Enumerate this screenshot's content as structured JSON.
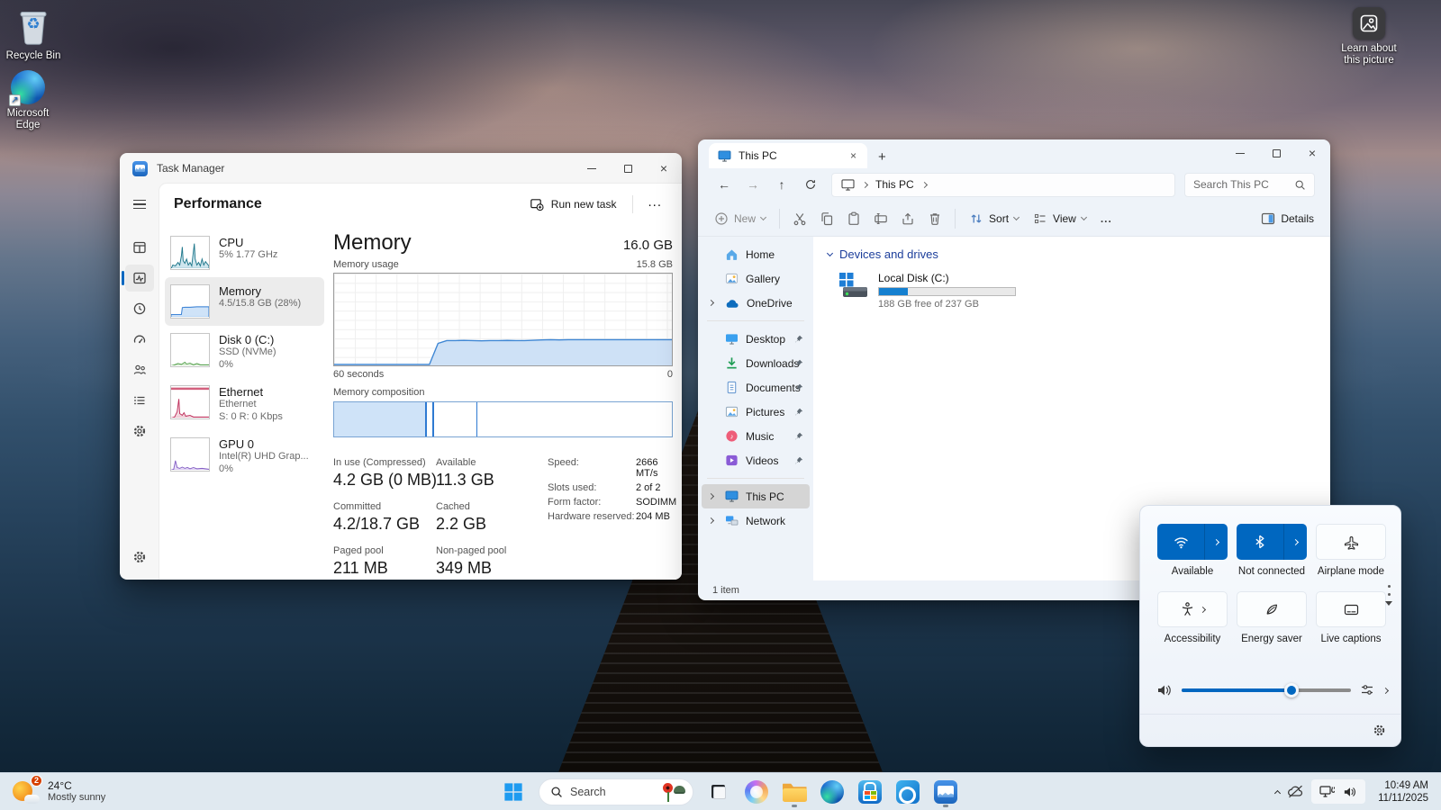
{
  "desktop": {
    "icons": [
      {
        "label": "Recycle Bin",
        "icon": "recycle-bin-icon"
      },
      {
        "label_line1": "Microsoft",
        "label_line2": "Edge",
        "icon": "edge-icon"
      }
    ],
    "learn_about": {
      "label_line1": "Learn about",
      "label_line2": "this picture",
      "icon": "picture-icon"
    }
  },
  "task_manager": {
    "window_title": "Task Manager",
    "page_title": "Performance",
    "run_new_task_label": "Run new task",
    "more_label": "...",
    "perf_items": [
      {
        "name": "CPU",
        "line1": "5% 1.77 GHz"
      },
      {
        "name": "Memory",
        "line1": "4.5/15.8 GB (28%)"
      },
      {
        "name": "Disk 0 (C:)",
        "line1": "SSD (NVMe)",
        "line2": "0%"
      },
      {
        "name": "Ethernet",
        "line1": "Ethernet",
        "line2": "S: 0 R: 0 Kbps"
      },
      {
        "name": "GPU 0",
        "line1": "Intel(R) UHD Grap...",
        "line2": "0%"
      }
    ],
    "memory": {
      "title": "Memory",
      "total": "16.0 GB",
      "usage_label": "Memory usage",
      "scale_top": "15.8 GB",
      "x_left": "60 seconds",
      "x_right": "0",
      "composition_label": "Memory composition",
      "stats": [
        {
          "label": "In use (Compressed)",
          "value": "4.2 GB (0 MB)"
        },
        {
          "label": "Available",
          "value": "11.3 GB"
        },
        {
          "label": "Committed",
          "value": "4.2/18.7 GB"
        },
        {
          "label": "Cached",
          "value": "2.2 GB"
        },
        {
          "label": "Paged pool",
          "value": "211 MB"
        },
        {
          "label": "Non-paged pool",
          "value": "349 MB"
        }
      ],
      "hardware": [
        {
          "label": "Speed:",
          "value": "2666 MT/s"
        },
        {
          "label": "Slots used:",
          "value": "2 of 2"
        },
        {
          "label": "Form factor:",
          "value": "SODIMM"
        },
        {
          "label": "Hardware reserved:",
          "value": "204 MB"
        }
      ],
      "usage_series_pct": [
        1,
        1,
        1,
        1,
        1,
        1,
        1,
        1,
        1,
        1,
        1,
        1,
        24,
        27,
        27,
        27.3,
        27,
        26.8,
        27,
        27,
        27.2,
        27,
        27,
        27.4,
        27.8,
        28,
        27.8,
        28,
        28,
        28,
        28,
        28,
        28,
        28,
        28,
        28,
        28,
        28,
        28,
        28
      ],
      "composition_segments_pct": [
        27.5,
        2,
        13,
        57.5
      ]
    }
  },
  "file_explorer": {
    "tab_title": "This PC",
    "breadcrumb": "This PC",
    "search_placeholder": "Search This PC",
    "toolbar": {
      "new_label": "New",
      "sort_label": "Sort",
      "view_label": "View",
      "more_label": "...",
      "details_label": "Details"
    },
    "nav": {
      "home": "Home",
      "gallery": "Gallery",
      "onedrive": "OneDrive",
      "desktop": "Desktop",
      "downloads": "Downloads",
      "documents": "Documents",
      "pictures": "Pictures",
      "music": "Music",
      "videos": "Videos",
      "this_pc": "This PC",
      "network": "Network"
    },
    "section_header": "Devices and drives",
    "drive": {
      "name": "Local Disk (C:)",
      "free_text": "188 GB free of 237 GB",
      "used_pct": 21
    },
    "status_bar": "1 item"
  },
  "quick_settings": {
    "tiles": [
      {
        "label": "Available",
        "icon": "wifi-icon",
        "active": true
      },
      {
        "label": "Not connected",
        "icon": "bluetooth-icon",
        "active": true
      },
      {
        "label": "Airplane mode",
        "icon": "airplane-icon",
        "active": false
      },
      {
        "label": "Accessibility",
        "icon": "accessibility-icon",
        "active": false
      },
      {
        "label": "Energy saver",
        "icon": "energy-saver-icon",
        "active": false
      },
      {
        "label": "Live captions",
        "icon": "live-captions-icon",
        "active": false
      }
    ],
    "volume_pct": 65
  },
  "taskbar": {
    "weather": {
      "temp": "24°C",
      "condition": "Mostly sunny",
      "badge": "2"
    },
    "search_placeholder": "Search",
    "clock": {
      "time": "10:49 AM",
      "date": "11/11/2025"
    }
  }
}
